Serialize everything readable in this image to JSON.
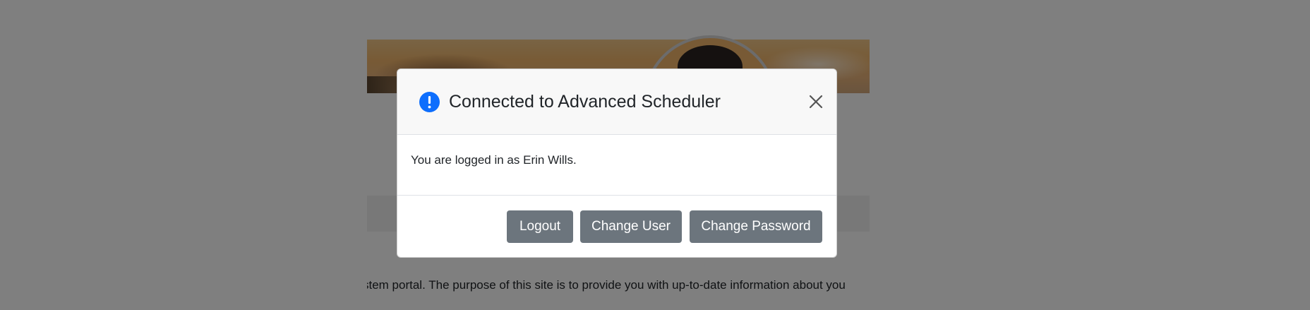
{
  "background": {
    "intro_text": "stem portal. The purpose of this site is to provide you with up-to-date information about you"
  },
  "modal": {
    "title": "Connected to Advanced Scheduler",
    "icon": "alert-icon",
    "body_text": "You are logged in as Erin Wills.",
    "buttons": {
      "logout": "Logout",
      "change_user": "Change User",
      "change_password": "Change Password"
    },
    "close_icon": "close-icon"
  },
  "colors": {
    "backdrop": "#000000",
    "button": "#6c757d",
    "alert_icon": "#0d6efd",
    "header_bg": "#f8f8f8"
  }
}
